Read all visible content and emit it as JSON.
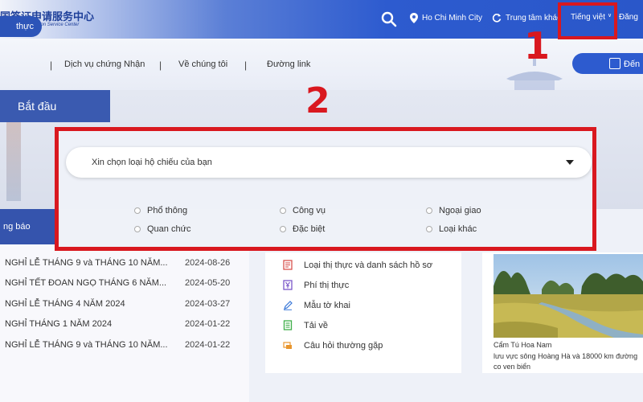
{
  "header": {
    "logo_cn": "国签证申请服务中心",
    "logo_en": "nese Visa Application Service Center",
    "location": "Ho Chi Minh City",
    "center": "Trung tâm khác",
    "language": "Tiếng việt",
    "login": "Đăng"
  },
  "nav": {
    "active": "thực",
    "items": [
      "Dịch vụ chứng Nhận",
      "Về chúng tôi",
      "Đường link"
    ],
    "appointment": "Đến"
  },
  "hero": {
    "start_tab": "Bắt đầu"
  },
  "form": {
    "select_placeholder": "Xin chọn loại hộ chiếu của bạn",
    "options": [
      "Phổ thông",
      "Công vụ",
      "Ngoại giao",
      "Quan chức",
      "Đặc biệt",
      "Loại khác"
    ]
  },
  "notices": {
    "header": "ng báo",
    "items": [
      {
        "title": "NGHỈ LỄ THÁNG 9 và THÁNG 10 NĂM...",
        "date": "2024-08-26"
      },
      {
        "title": "NGHỈ TẾT ĐOAN NGỌ THÁNG 6 NĂM...",
        "date": "2024-05-20"
      },
      {
        "title": "NGHỈ LỄ THÁNG 4 NĂM 2024",
        "date": "2024-03-27"
      },
      {
        "title": "NGHỈ THÁNG 1 NĂM 2024",
        "date": "2024-01-22"
      },
      {
        "title": "NGHỈ LỄ THÁNG 9 và THÁNG 10 NĂM...",
        "date": "2024-01-22"
      }
    ]
  },
  "links": [
    {
      "label": "Loại thị thực và danh sách hồ sơ",
      "icon": "document-list-icon",
      "color": "#d9534f"
    },
    {
      "label": "Phí thị thực",
      "icon": "yen-fee-icon",
      "color": "#7b57c9"
    },
    {
      "label": "Mẫu tờ khai",
      "icon": "pen-form-icon",
      "color": "#3b79d8"
    },
    {
      "label": "Tải về",
      "icon": "download-doc-icon",
      "color": "#3fae49"
    },
    {
      "label": "Câu hỏi thường gặp",
      "icon": "faq-icon",
      "color": "#e8962e"
    }
  ],
  "photo": {
    "title": "Cẩm Tú Hoa Nam",
    "description": "lưu vực sông Hoàng Hà và 18000 km đường co ven biển"
  },
  "annotations": {
    "one": "1",
    "two": "2"
  },
  "colors": {
    "brand_blue": "#2d5bcf",
    "highlight_red": "#d9181f"
  }
}
